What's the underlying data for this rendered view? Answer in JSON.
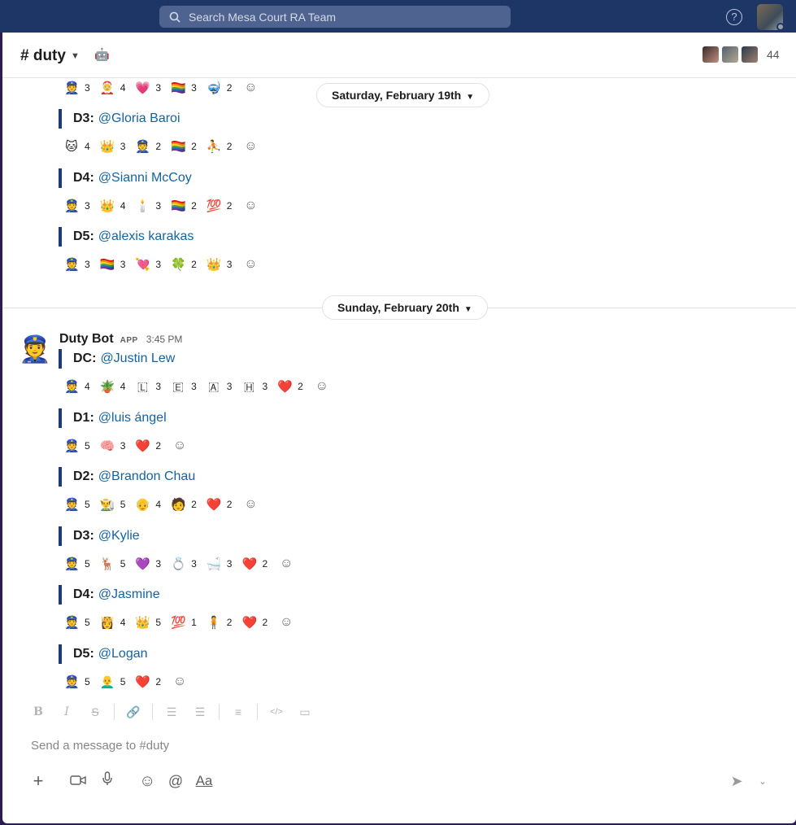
{
  "workspace": {
    "search_placeholder": "Search Mesa Court RA Team"
  },
  "top_bar": {
    "help_glyph": "?"
  },
  "channel": {
    "name": "# duty",
    "member_count": "44"
  },
  "dates": {
    "date1": "Saturday, February 19th",
    "date2": "Sunday, February 20th"
  },
  "previous_message": {
    "top_reactions": [
      {
        "emoji": "👮",
        "count": "3"
      },
      {
        "emoji": "🤶",
        "count": "4"
      },
      {
        "emoji": "💗",
        "count": "3"
      },
      {
        "emoji": "🏳️‍🌈",
        "count": "3"
      },
      {
        "emoji": "🤿",
        "count": "2"
      }
    ],
    "lines": [
      {
        "label": "D3:",
        "mention": "@Gloria Baroi",
        "reactions": [
          {
            "emoji": "🐱",
            "count": "4"
          },
          {
            "emoji": "👑",
            "count": "3"
          },
          {
            "emoji": "👮",
            "count": "2"
          },
          {
            "emoji": "🏳️‍🌈",
            "count": "2"
          },
          {
            "emoji": "⛹️",
            "count": "2"
          }
        ]
      },
      {
        "label": "D4:",
        "mention": "@Sianni McCoy",
        "reactions": [
          {
            "emoji": "👮",
            "count": "3"
          },
          {
            "emoji": "👑",
            "count": "4"
          },
          {
            "emoji": "🕯️",
            "count": "3"
          },
          {
            "emoji": "🏳️‍🌈",
            "count": "2"
          },
          {
            "emoji": "💯",
            "count": "2"
          }
        ]
      },
      {
        "label": "D5:",
        "mention": "@alexis karakas",
        "reactions": [
          {
            "emoji": "👮",
            "count": "3"
          },
          {
            "emoji": "🏳️‍🌈",
            "count": "3"
          },
          {
            "emoji": "💘",
            "count": "3"
          },
          {
            "emoji": "🍀",
            "count": "2"
          },
          {
            "emoji": "👑",
            "count": "3"
          }
        ]
      }
    ]
  },
  "message": {
    "sender": "Duty Bot",
    "badge": "APP",
    "time": "3:45 PM",
    "lines": [
      {
        "label": "DC:",
        "mention": "@Justin Lew",
        "reactions": [
          {
            "emoji": "👮",
            "count": "4"
          },
          {
            "emoji": "🪴",
            "count": "4"
          },
          {
            "emoji": "🇱",
            "count": "3"
          },
          {
            "emoji": "🇪",
            "count": "3"
          },
          {
            "emoji": "🇦",
            "count": "3"
          },
          {
            "emoji": "🇭",
            "count": "3"
          },
          {
            "emoji": "❤️",
            "count": "2"
          }
        ]
      },
      {
        "label": "D1:",
        "mention": "@luis ángel",
        "reactions": [
          {
            "emoji": "👮",
            "count": "5"
          },
          {
            "emoji": "🧠",
            "count": "3"
          },
          {
            "emoji": "❤️",
            "count": "2"
          }
        ]
      },
      {
        "label": "D2:",
        "mention": "@Brandon Chau",
        "reactions": [
          {
            "emoji": "👮",
            "count": "5"
          },
          {
            "emoji": "👨‍🌾",
            "count": "5"
          },
          {
            "emoji": "👴",
            "count": "4"
          },
          {
            "emoji": "🧑",
            "count": "2"
          },
          {
            "emoji": "❤️",
            "count": "2"
          }
        ]
      },
      {
        "label": "D3:",
        "mention": "@Kylie",
        "reactions": [
          {
            "emoji": "👮",
            "count": "5"
          },
          {
            "emoji": "🦌",
            "count": "5"
          },
          {
            "emoji": "💜",
            "count": "3"
          },
          {
            "emoji": "💍",
            "count": "3"
          },
          {
            "emoji": "🛁",
            "count": "3"
          },
          {
            "emoji": "❤️",
            "count": "2"
          }
        ]
      },
      {
        "label": "D4:",
        "mention": "@Jasmine",
        "reactions": [
          {
            "emoji": "👮",
            "count": "5"
          },
          {
            "emoji": "👸",
            "count": "4"
          },
          {
            "emoji": "👑",
            "count": "5"
          },
          {
            "emoji": "💯",
            "count": "1"
          },
          {
            "emoji": "🧍",
            "count": "2"
          },
          {
            "emoji": "❤️",
            "count": "2"
          }
        ]
      },
      {
        "label": "D5:",
        "mention": "@Logan",
        "reactions": [
          {
            "emoji": "👮",
            "count": "5"
          },
          {
            "emoji": "👨‍🦲",
            "count": "5"
          },
          {
            "emoji": "❤️",
            "count": "2"
          }
        ]
      }
    ]
  },
  "composer": {
    "placeholder": "Send a message to #duty",
    "format_glyphs": {
      "bold": "B",
      "italic": "I",
      "strike": "S"
    },
    "text_format_label": "Aa"
  },
  "icons": {
    "add_reaction": "☺",
    "plus": "+",
    "emoji": "☺",
    "mention": "@",
    "send": "➤",
    "chevron": "⌄"
  }
}
